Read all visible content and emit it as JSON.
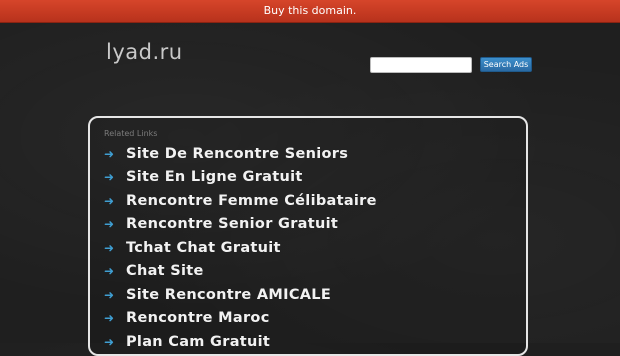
{
  "topbar": {
    "text": "Buy this domain."
  },
  "logo": {
    "text": "lyad.ru"
  },
  "search": {
    "placeholder": "",
    "button_label": "Search Ads"
  },
  "related": {
    "title": "Related Links",
    "links": [
      "Site De Rencontre Seniors",
      "Site En Ligne Gratuit",
      "Rencontre Femme Célibataire",
      "Rencontre Senior Gratuit",
      "Tchat Chat Gratuit",
      "Chat Site",
      "Site Rencontre AMICALE",
      "Rencontre Maroc",
      "Plan Cam Gratuit"
    ]
  },
  "colors": {
    "topbar": "#c73b22",
    "accent": "#3f9fd3",
    "background": "#1f1f1f"
  },
  "icons": {
    "link_arrow": "arrow-right-icon"
  }
}
